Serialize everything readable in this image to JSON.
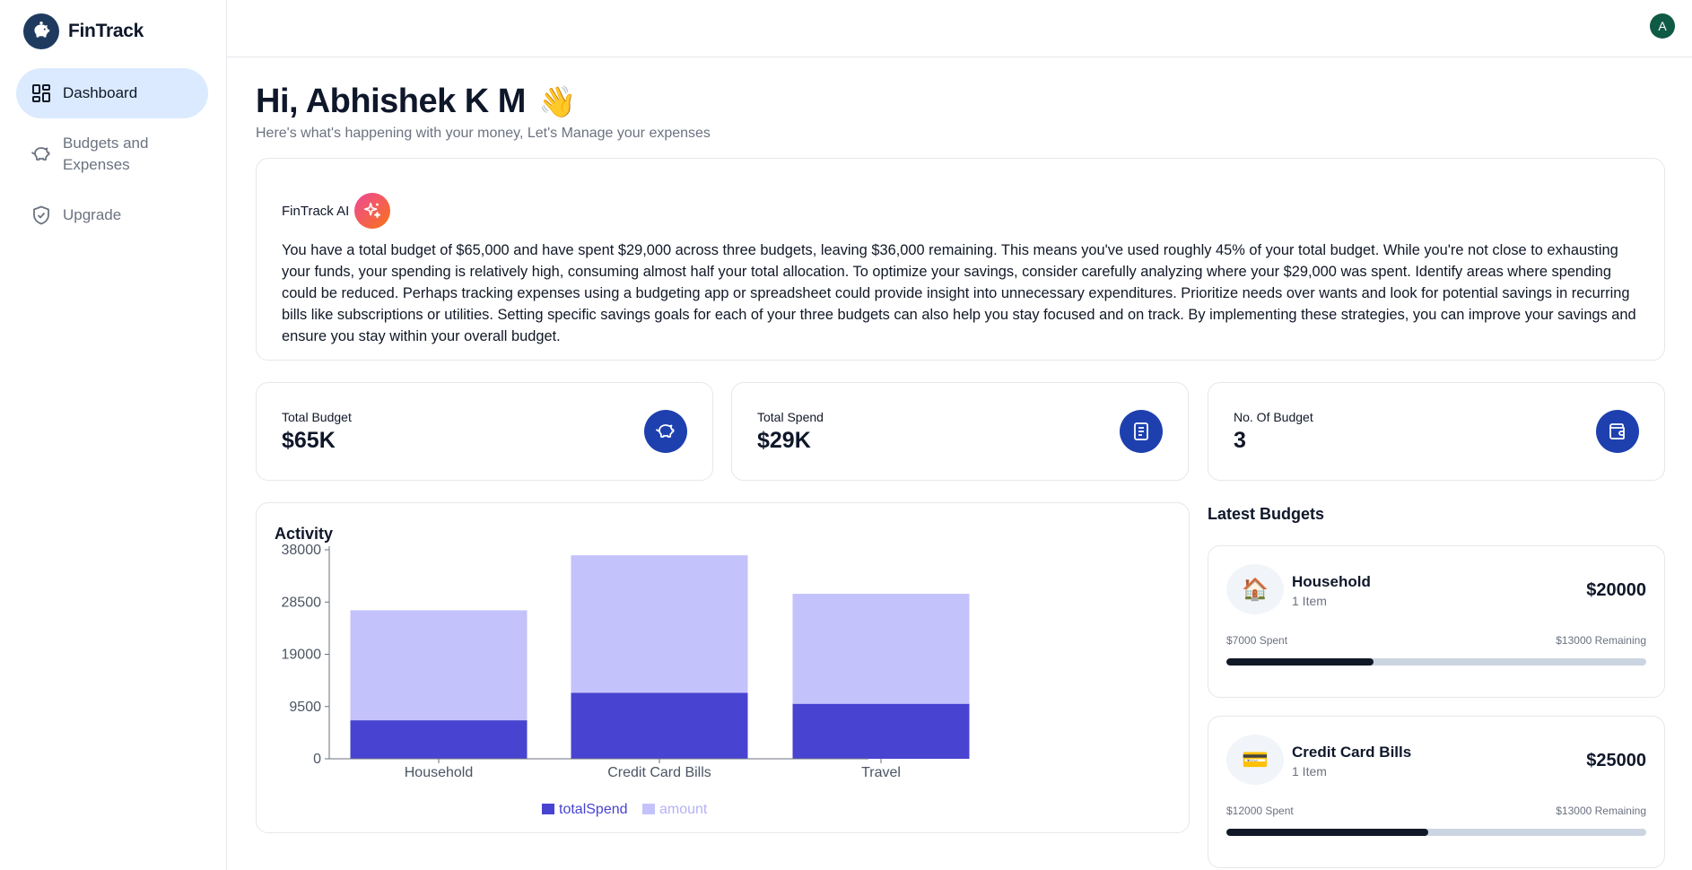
{
  "app": {
    "name": "FinTrack"
  },
  "sidebar": {
    "items": [
      {
        "label": "Dashboard",
        "icon": "dashboard-grid-icon",
        "active": true
      },
      {
        "label": "Budgets and Expenses",
        "icon": "piggy-bank-icon",
        "active": false
      },
      {
        "label": "Upgrade",
        "icon": "shield-check-icon",
        "active": false
      }
    ]
  },
  "header": {
    "avatar_initial": "A"
  },
  "greeting": {
    "title": "Hi, Abhishek K M",
    "emoji": "👋",
    "subtitle": "Here's what's happening with your money, Let's Manage your expenses"
  },
  "ai": {
    "title": "FinTrack AI",
    "text": "You have a total budget of $65,000 and have spent $29,000 across three budgets, leaving $36,000 remaining. This means you've used roughly 45% of your total budget. While you're not close to exhausting your funds, your spending is relatively high, consuming almost half your total allocation. To optimize your savings, consider carefully analyzing where your $29,000 was spent. Identify areas where spending could be reduced. Perhaps tracking expenses using a budgeting app or spreadsheet could provide insight into unnecessary expenditures. Prioritize needs over wants and look for potential savings in recurring bills like subscriptions or utilities. Setting specific savings goals for each of your three budgets can also help you stay focused and on track. By implementing these strategies, you can improve your savings and ensure you stay within your overall budget."
  },
  "stats": [
    {
      "label": "Total Budget",
      "value": "$65K",
      "icon": "piggy-bank-icon"
    },
    {
      "label": "Total Spend",
      "value": "$29K",
      "icon": "receipt-icon"
    },
    {
      "label": "No. Of Budget",
      "value": "3",
      "icon": "wallet-icon"
    }
  ],
  "activity": {
    "title": "Activity"
  },
  "chart_data": {
    "type": "bar",
    "stacked": true,
    "title": "Activity",
    "categories": [
      "Household",
      "Credit Card Bills",
      "Travel"
    ],
    "series": [
      {
        "name": "totalSpend",
        "values": [
          7000,
          12000,
          10000
        ],
        "color": "#4843d0"
      },
      {
        "name": "amount",
        "values": [
          20000,
          25000,
          20000
        ],
        "color": "#c4c2fb"
      }
    ],
    "y_ticks": [
      "0",
      "9500",
      "19000",
      "28500",
      "38000"
    ],
    "ylim": [
      0,
      38000
    ],
    "grid": false,
    "legend": "bottom-center"
  },
  "latest": {
    "title": "Latest Budgets",
    "budgets": [
      {
        "emoji": "🏠",
        "name": "Household",
        "items": "1 Item",
        "amount": "$20000",
        "spent": "$7000 Spent",
        "remaining": "$13000 Remaining",
        "progress": 0.35
      },
      {
        "emoji": "💳",
        "name": "Credit Card Bills",
        "items": "1 Item",
        "amount": "$25000",
        "spent": "$12000 Spent",
        "remaining": "$13000 Remaining",
        "progress": 0.48
      }
    ]
  },
  "colors": {
    "accent": "#1e40af",
    "active_nav": "#dbeafe",
    "bar_dark": "#4843d0",
    "bar_light": "#c4c2fb"
  }
}
